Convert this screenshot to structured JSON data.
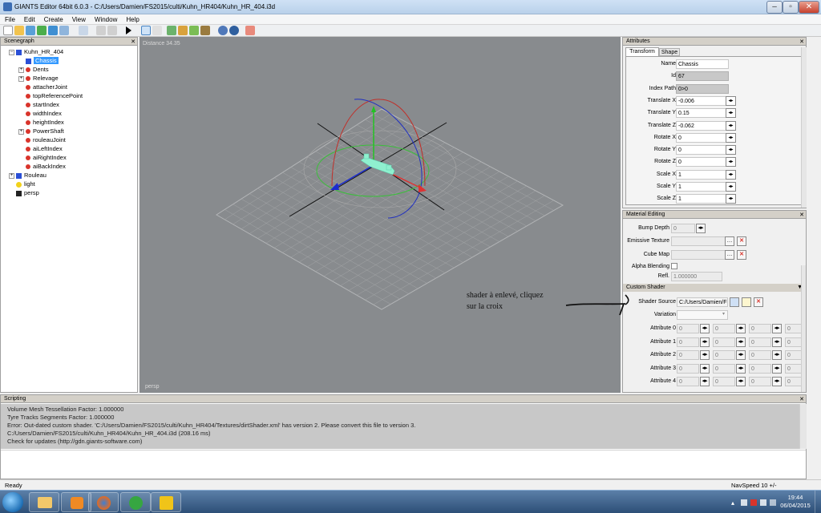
{
  "window": {
    "title": "GIANTS Editor 64bit 6.0.3 - C:/Users/Damien/FS2015/culti/Kuhn_HR404/Kuhn_HR_404.i3d"
  },
  "menu": [
    "File",
    "Edit",
    "Create",
    "View",
    "Window",
    "Help"
  ],
  "scenegraph": {
    "header": "Scenegraph",
    "items": [
      {
        "label": "Kuhn_HR_404",
        "level": 0,
        "icon": "cube-icon",
        "expandable": true
      },
      {
        "label": "Chassis",
        "level": 1,
        "icon": "cube-icon",
        "selected": true
      },
      {
        "label": "Dents",
        "level": 1,
        "icon": "transform-group-icon",
        "expandable": true
      },
      {
        "label": "Relevage",
        "level": 1,
        "icon": "transform-group-icon",
        "expandable": true
      },
      {
        "label": "attacherJoint",
        "level": 1,
        "icon": "transform-group-icon"
      },
      {
        "label": "topReferencePoint",
        "level": 1,
        "icon": "transform-group-icon"
      },
      {
        "label": "startIndex",
        "level": 1,
        "icon": "transform-group-icon"
      },
      {
        "label": "widthIndex",
        "level": 1,
        "icon": "transform-group-icon"
      },
      {
        "label": "heightIndex",
        "level": 1,
        "icon": "transform-group-icon"
      },
      {
        "label": "PowerShaft",
        "level": 1,
        "icon": "transform-group-icon",
        "expandable": true
      },
      {
        "label": "rouleauJoint",
        "level": 1,
        "icon": "transform-group-icon"
      },
      {
        "label": "aiLeftIndex",
        "level": 1,
        "icon": "transform-group-icon"
      },
      {
        "label": "aiRightIndex",
        "level": 1,
        "icon": "transform-group-icon"
      },
      {
        "label": "aiBackIndex",
        "level": 1,
        "icon": "transform-group-icon"
      },
      {
        "label": "Rouleau",
        "level": 0,
        "icon": "cube-icon",
        "expandable": true
      },
      {
        "label": "light",
        "level": 0,
        "icon": "light-bulb-icon"
      },
      {
        "label": "persp",
        "level": 0,
        "icon": "camera-icon"
      }
    ]
  },
  "viewport": {
    "distance": "Distance 34.35",
    "camera": "persp"
  },
  "attributes": {
    "header": "Attributes",
    "tabs": [
      "Transform",
      "Shape"
    ],
    "active_tab": "Transform",
    "rows": [
      {
        "label": "Name",
        "value": "Chassis",
        "readonly": false,
        "spinner": false
      },
      {
        "label": "Id",
        "value": "67",
        "readonly": true,
        "spinner": false
      },
      {
        "label": "Index Path",
        "value": "0>0",
        "readonly": true,
        "spinner": false
      },
      {
        "label": "Translate X",
        "value": "-0.006",
        "readonly": false,
        "spinner": true
      },
      {
        "label": "Translate Y",
        "value": "0.15",
        "readonly": false,
        "spinner": true
      },
      {
        "label": "Translate Z",
        "value": "-0.062",
        "readonly": false,
        "spinner": true
      },
      {
        "label": "Rotate X",
        "value": "0",
        "readonly": false,
        "spinner": true
      },
      {
        "label": "Rotate Y",
        "value": "0",
        "readonly": false,
        "spinner": true
      },
      {
        "label": "Rotate Z",
        "value": "0",
        "readonly": false,
        "spinner": true
      },
      {
        "label": "Scale X",
        "value": "1",
        "readonly": false,
        "spinner": true
      },
      {
        "label": "Scale Y",
        "value": "1",
        "readonly": false,
        "spinner": true
      },
      {
        "label": "Scale Z",
        "value": "1",
        "readonly": false,
        "spinner": true
      }
    ]
  },
  "material": {
    "header": "Material Editing",
    "bump_depth_label": "Bump Depth",
    "bump_depth_value": "0",
    "emissive_label": "Emissive Texture",
    "cubemap_label": "Cube Map",
    "alpha_label": "Alpha Blending",
    "refl_label": "Refl.",
    "refl_value": "1.000000",
    "custom_shader_header": "Custom Shader",
    "shader_source_label": "Shader Source",
    "shader_source_value": "C:/Users/Damien/F",
    "variation_label": "Variation",
    "attributes": [
      {
        "label": "Attribute 0",
        "values": [
          "0",
          "0",
          "0",
          "0"
        ]
      },
      {
        "label": "Attribute 1",
        "values": [
          "0",
          "0",
          "0",
          "0"
        ]
      },
      {
        "label": "Attribute 2",
        "values": [
          "0",
          "0",
          "0",
          "0"
        ]
      },
      {
        "label": "Attribute 3",
        "values": [
          "0",
          "0",
          "0",
          "0"
        ]
      },
      {
        "label": "Attribute 4",
        "values": [
          "0",
          "0",
          "0",
          "0"
        ]
      }
    ]
  },
  "annotation": {
    "line1": "shader à enlevé, cliquez",
    "line2": "sur la croix"
  },
  "scripting": {
    "header": "Scripting",
    "lines": [
      " Volume Mesh Tessellation Factor: 1.000000",
      " Tyre Tracks Segments Factor: 1.000000",
      "Error: Out-dated custom shader. 'C:/Users/Damien/FS2015/culti/Kuhn_HR404/Textures/dirtShader.xml' has version 2. Please convert this file to version 3.",
      "C:/Users/Damien/FS2015/culti/Kuhn_HR404/Kuhn_HR_404.i3d (208.16 ms)",
      "Check for updates (http://gdn.giants-software.com)"
    ]
  },
  "status": {
    "left": "Ready",
    "right": "NavSpeed 10 +/-"
  },
  "taskbar": {
    "time": "19:44",
    "date": "06/04/2015"
  },
  "colors": {
    "selection": "#3399ff",
    "viewport_bg": "#888b8e",
    "error_red": "#d9342b"
  }
}
